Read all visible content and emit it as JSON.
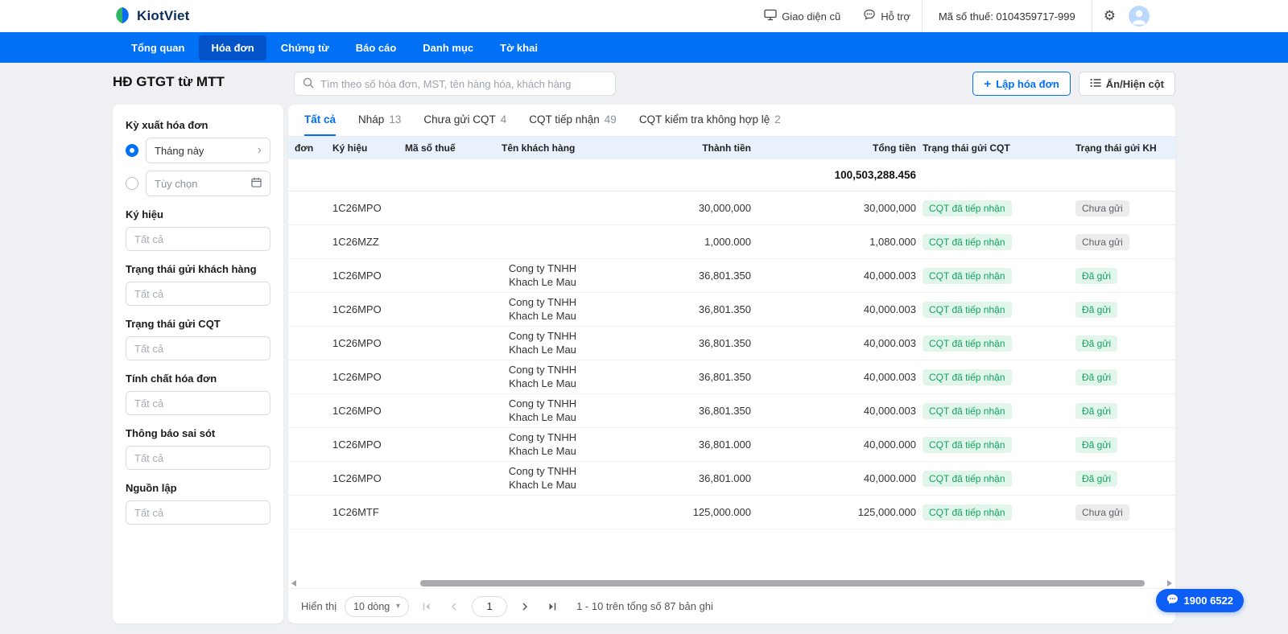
{
  "brand": {
    "name": "KiotViet"
  },
  "topbar": {
    "old_ui": "Giao diện cũ",
    "support": "Hỗ trợ",
    "tax_code": "Mã số thuế: 0104359717-999"
  },
  "nav": {
    "items": [
      {
        "label": "Tổng quan"
      },
      {
        "label": "Hóa đơn"
      },
      {
        "label": "Chứng từ"
      },
      {
        "label": "Báo cáo"
      },
      {
        "label": "Danh mục"
      },
      {
        "label": "Tờ khai"
      }
    ],
    "active_index": 1
  },
  "page": {
    "title": "HĐ GTGT từ MTT",
    "search_placeholder": "Tìm theo số hóa đơn, MST, tên hàng hóa, khách hàng",
    "create_button_plus": "+",
    "create_button": "Lập hóa đơn",
    "columns_button": "Ẩn/Hiện cột"
  },
  "filters": {
    "period_label": "Kỳ xuất hóa đơn",
    "period_options": [
      {
        "label": "Tháng này",
        "selected": true
      },
      {
        "label": "Tùy chọn",
        "selected": false
      }
    ],
    "fields": [
      {
        "label": "Ký hiệu",
        "placeholder": "Tất cả"
      },
      {
        "label": "Trạng thái gửi khách hàng",
        "placeholder": "Tất cả"
      },
      {
        "label": "Trạng thái gửi CQT",
        "placeholder": "Tất cả"
      },
      {
        "label": "Tính chất hóa đơn",
        "placeholder": "Tất cả"
      },
      {
        "label": "Thông báo sai sót",
        "placeholder": "Tất cả"
      },
      {
        "label": "Nguồn lập",
        "placeholder": "Tất cả"
      }
    ]
  },
  "tabs": [
    {
      "label": "Tất cả",
      "count": ""
    },
    {
      "label": "Nháp",
      "count": "13"
    },
    {
      "label": "Chưa gửi CQT",
      "count": "4"
    },
    {
      "label": "CQT tiếp nhận",
      "count": "49"
    },
    {
      "label": "CQT kiểm tra không hợp lệ",
      "count": "2"
    }
  ],
  "table": {
    "columns": [
      "đơn",
      "Ký hiệu",
      "Mã số thuế",
      "Tên khách hàng",
      "Thành tiền",
      "Tổng tiền",
      "Trạng thái gửi CQT",
      "Trạng thái gửi KH"
    ],
    "total": "100,503,288.456",
    "rows": [
      {
        "so": "",
        "ky_hieu": "1C26MPO",
        "mst": "",
        "ten_kh": "",
        "thanh_tien": "30,000,000",
        "tong_tien": "30,000,000",
        "cqt": "CQT đã tiếp nhận",
        "kh": "Chưa gửi",
        "kh_sent": false
      },
      {
        "so": "",
        "ky_hieu": "1C26MZZ",
        "mst": "",
        "ten_kh": "",
        "thanh_tien": "1,000.000",
        "tong_tien": "1,080.000",
        "cqt": "CQT đã tiếp nhận",
        "kh": "Chưa gửi",
        "kh_sent": false
      },
      {
        "so": "",
        "ky_hieu": "1C26MPO",
        "mst": "",
        "ten_kh": "Cong ty TNHH Khach Le Mau",
        "thanh_tien": "36,801.350",
        "tong_tien": "40,000.003",
        "cqt": "CQT đã tiếp nhận",
        "kh": "Đã gửi",
        "kh_sent": true
      },
      {
        "so": "",
        "ky_hieu": "1C26MPO",
        "mst": "",
        "ten_kh": "Cong ty TNHH Khach Le Mau",
        "thanh_tien": "36,801.350",
        "tong_tien": "40,000.003",
        "cqt": "CQT đã tiếp nhận",
        "kh": "Đã gửi",
        "kh_sent": true
      },
      {
        "so": "",
        "ky_hieu": "1C26MPO",
        "mst": "",
        "ten_kh": "Cong ty TNHH Khach Le Mau",
        "thanh_tien": "36,801.350",
        "tong_tien": "40,000.003",
        "cqt": "CQT đã tiếp nhận",
        "kh": "Đã gửi",
        "kh_sent": true
      },
      {
        "so": "",
        "ky_hieu": "1C26MPO",
        "mst": "",
        "ten_kh": "Cong ty TNHH Khach Le Mau",
        "thanh_tien": "36,801.350",
        "tong_tien": "40,000.003",
        "cqt": "CQT đã tiếp nhận",
        "kh": "Đã gửi",
        "kh_sent": true
      },
      {
        "so": "",
        "ky_hieu": "1C26MPO",
        "mst": "",
        "ten_kh": "Cong ty TNHH Khach Le Mau",
        "thanh_tien": "36,801.350",
        "tong_tien": "40,000.003",
        "cqt": "CQT đã tiếp nhận",
        "kh": "Đã gửi",
        "kh_sent": true
      },
      {
        "so": "",
        "ky_hieu": "1C26MPO",
        "mst": "",
        "ten_kh": "Cong ty TNHH Khach Le Mau",
        "thanh_tien": "36,801.000",
        "tong_tien": "40,000.000",
        "cqt": "CQT đã tiếp nhận",
        "kh": "Đã gửi",
        "kh_sent": true
      },
      {
        "so": "",
        "ky_hieu": "1C26MPO",
        "mst": "",
        "ten_kh": "Cong ty TNHH Khach Le Mau",
        "thanh_tien": "36,801.000",
        "tong_tien": "40,000.000",
        "cqt": "CQT đã tiếp nhận",
        "kh": "Đã gửi",
        "kh_sent": true
      },
      {
        "so": "",
        "ky_hieu": "1C26MTF",
        "mst": "",
        "ten_kh": "",
        "thanh_tien": "125,000.000",
        "tong_tien": "125,000.000",
        "cqt": "CQT đã tiếp nhận",
        "kh": "Chưa gửi",
        "kh_sent": false
      }
    ]
  },
  "pagination": {
    "show_label": "Hiển thị",
    "page_size": "10 dòng",
    "page": "1",
    "summary": "1 - 10 trên tổng số 87 bản ghi"
  },
  "hotline": {
    "phone": "1900 6522"
  },
  "colors": {
    "brand_blue": "#0070f4",
    "nav_active_blue": "#0353c8",
    "badge_green_bg": "#e2f5eb",
    "badge_green_text": "#12a45f",
    "badge_gray_bg": "#ececec",
    "table_header_bg": "#e9f1fc"
  }
}
